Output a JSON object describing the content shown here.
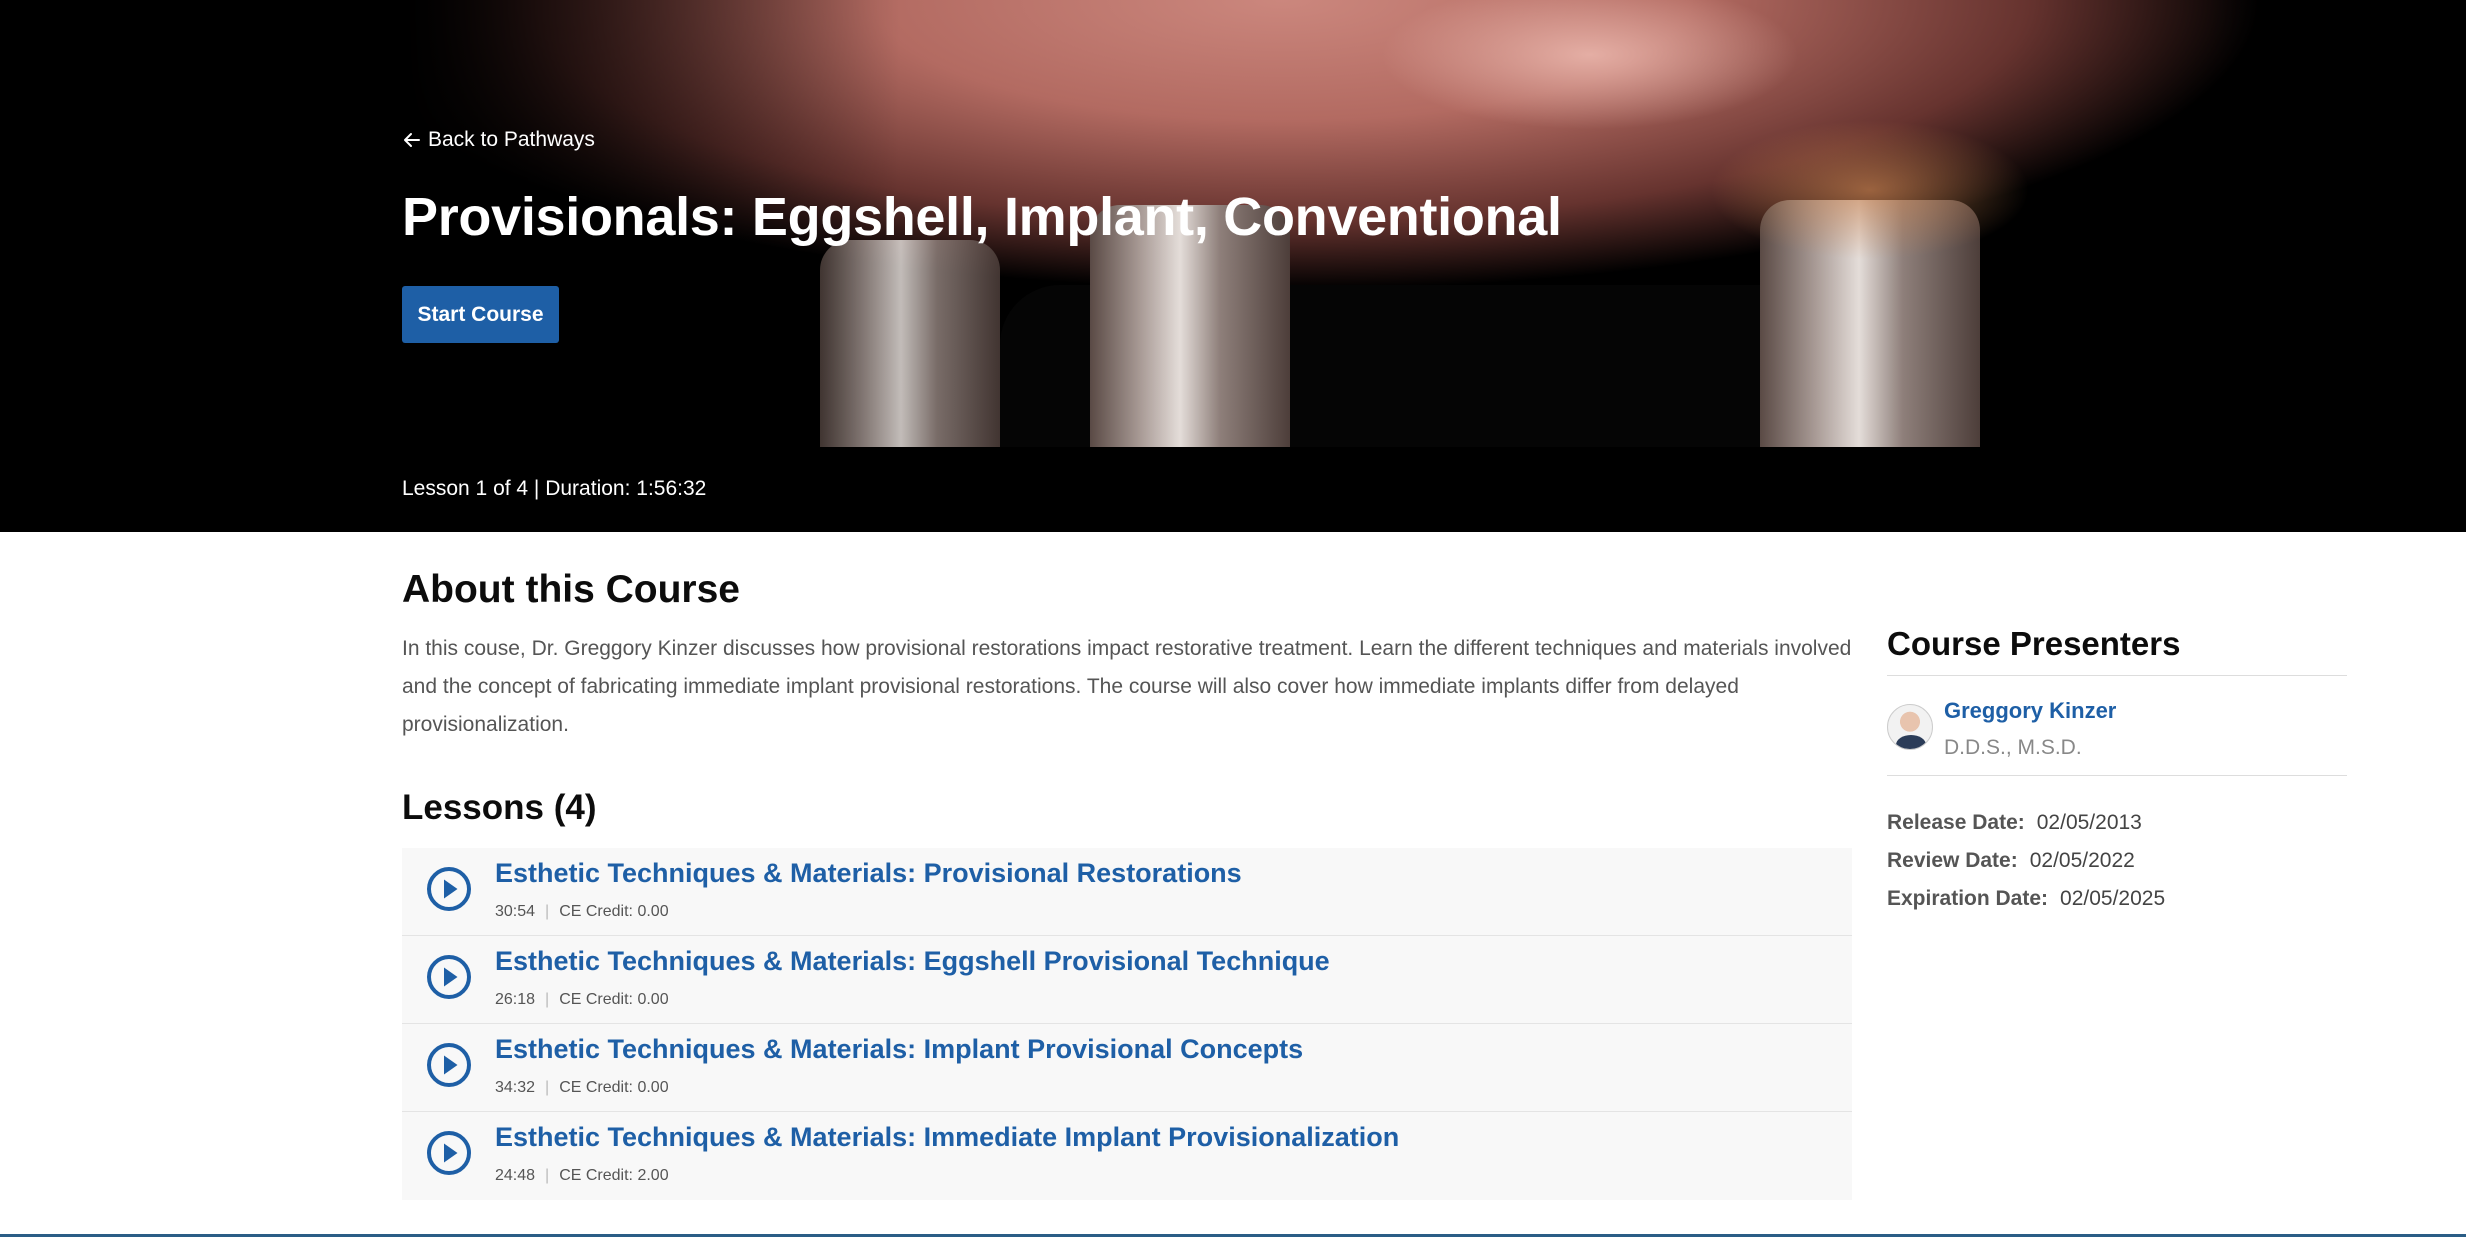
{
  "hero": {
    "back_label": "Back to Pathways",
    "title": "Provisionals: Eggshell, Implant, Conventional",
    "start_label": "Start Course",
    "lesson_meta": "Lesson 1 of 4 | Duration: 1:56:32"
  },
  "about": {
    "title": "About this Course",
    "text": "In this couse, Dr. Greggory Kinzer discusses how provisional restorations impact restorative treatment. Learn the different techniques and materials involved and the concept of fabricating immediate implant provisional restorations. The course will also cover how immediate implants differ from delayed provisionalization."
  },
  "lessons": {
    "title": "Lessons (4)",
    "items": [
      {
        "name": "Esthetic Techniques & Materials: Provisional Restorations",
        "duration": "30:54",
        "credit": "CE Credit: 0.00"
      },
      {
        "name": "Esthetic Techniques & Materials: Eggshell Provisional Technique",
        "duration": "26:18",
        "credit": "CE Credit: 0.00"
      },
      {
        "name": "Esthetic Techniques & Materials: Implant Provisional Concepts",
        "duration": "34:32",
        "credit": "CE Credit: 0.00"
      },
      {
        "name": "Esthetic Techniques & Materials: Immediate Implant Provisionalization",
        "duration": "24:48",
        "credit": "CE Credit: 2.00"
      }
    ]
  },
  "presenters": {
    "title": "Course Presenters",
    "items": [
      {
        "name": "Greggory Kinzer",
        "credentials": "D.D.S., M.S.D."
      }
    ]
  },
  "dates": {
    "release_label": "Release Date:",
    "release_value": "02/05/2013",
    "review_label": "Review Date:",
    "review_value": "02/05/2022",
    "expiration_label": "Expiration Date:",
    "expiration_value": "02/05/2025"
  },
  "colors": {
    "accent": "#1e5fa6",
    "hero_bg": "#000000"
  },
  "icons": {
    "back": "arrow-left-icon",
    "play": "play-circle-icon",
    "avatar": "presenter-avatar"
  }
}
